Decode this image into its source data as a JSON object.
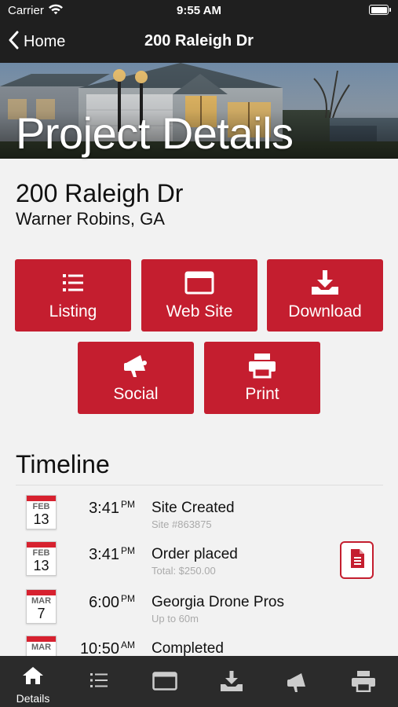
{
  "status_bar": {
    "carrier": "Carrier",
    "time": "9:55 AM"
  },
  "nav": {
    "back_label": "Home",
    "title": "200 Raleigh Dr"
  },
  "hero": {
    "title": "Project Details"
  },
  "property": {
    "address": "200 Raleigh Dr",
    "city": "Warner Robins, GA"
  },
  "actions": [
    {
      "label": "Listing",
      "icon": "list-icon"
    },
    {
      "label": "Web Site",
      "icon": "browser-window-icon"
    },
    {
      "label": "Download",
      "icon": "download-icon"
    },
    {
      "label": "Social",
      "icon": "megaphone-icon"
    },
    {
      "label": "Print",
      "icon": "printer-icon"
    }
  ],
  "timeline": {
    "heading": "Timeline",
    "events": [
      {
        "month": "FEB",
        "day": "13",
        "time": "3:41",
        "ampm": "PM",
        "title": "Site Created",
        "subtitle": "Site #863875"
      },
      {
        "month": "FEB",
        "day": "13",
        "time": "3:41",
        "ampm": "PM",
        "title": "Order placed",
        "subtitle": "Total: $250.00",
        "action_icon": "invoice-icon"
      },
      {
        "month": "MAR",
        "day": "7",
        "time": "6:00",
        "ampm": "PM",
        "title": "Georgia Drone Pros",
        "subtitle": "Up to 60m"
      },
      {
        "month": "MAR",
        "day": "",
        "time": "10:50",
        "ampm": "AM",
        "title": "Completed",
        "subtitle": ""
      }
    ]
  },
  "tab_bar": {
    "tabs": [
      {
        "label": "Details",
        "icon": "home-icon",
        "active": true
      },
      {
        "label": "",
        "icon": "list-icon"
      },
      {
        "label": "",
        "icon": "browser-window-icon"
      },
      {
        "label": "",
        "icon": "download-icon"
      },
      {
        "label": "",
        "icon": "megaphone-icon"
      },
      {
        "label": "",
        "icon": "printer-icon"
      }
    ]
  },
  "colors": {
    "accent": "#c41e2f",
    "bar_background": "#1f1f1f",
    "tab_background": "#2b2b2b",
    "page_background": "#f2f2f2"
  }
}
